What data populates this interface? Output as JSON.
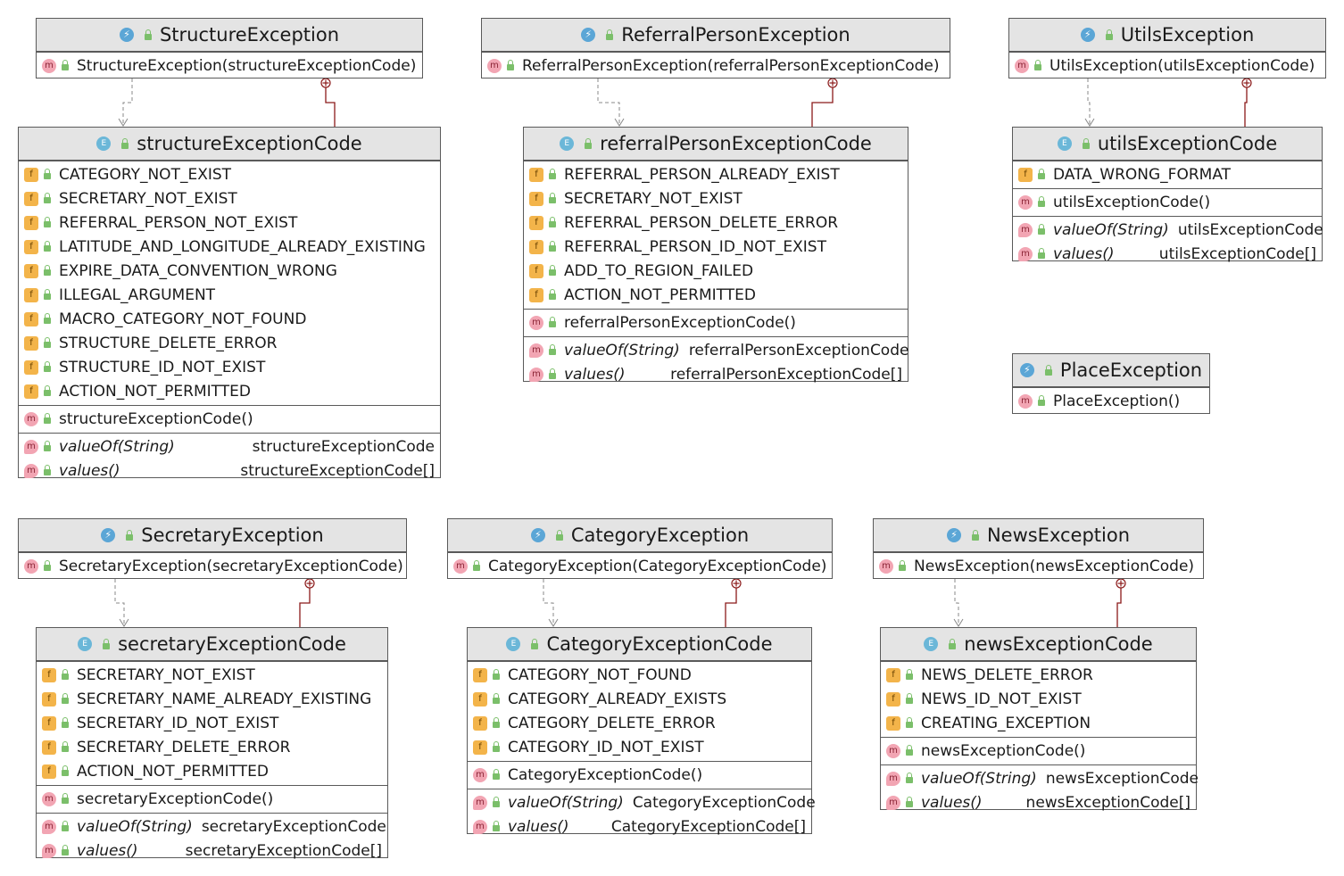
{
  "exceptions": {
    "structure": {
      "name": "StructureException",
      "ctor": "StructureException(structureExceptionCode)"
    },
    "referral": {
      "name": "ReferralPersonException",
      "ctor": "ReferralPersonException(referralPersonExceptionCode)"
    },
    "utils": {
      "name": "UtilsException",
      "ctor": "UtilsException(utilsExceptionCode)"
    },
    "place": {
      "name": "PlaceException",
      "ctor": "PlaceException()"
    },
    "secretary": {
      "name": "SecretaryException",
      "ctor": "SecretaryException(secretaryExceptionCode)"
    },
    "category": {
      "name": "CategoryException",
      "ctor": "CategoryException(CategoryExceptionCode)"
    },
    "news": {
      "name": "NewsException",
      "ctor": "NewsException(newsExceptionCode)"
    }
  },
  "enums": {
    "structure": {
      "name": "structureExceptionCode",
      "fields": [
        "CATEGORY_NOT_EXIST",
        "SECRETARY_NOT_EXIST",
        "REFERRAL_PERSON_NOT_EXIST",
        "LATITUDE_AND_LONGITUDE_ALREADY_EXISTING",
        "EXPIRE_DATA_CONVENTION_WRONG",
        "ILLEGAL_ARGUMENT",
        "MACRO_CATEGORY_NOT_FOUND",
        "STRUCTURE_DELETE_ERROR",
        "STRUCTURE_ID_NOT_EXIST",
        "ACTION_NOT_PERMITTED"
      ],
      "ctor": "structureExceptionCode()",
      "valueOf": "valueOf(String)",
      "valueOf_type": "structureExceptionCode",
      "values": "values()",
      "values_type": "structureExceptionCode[]"
    },
    "referral": {
      "name": "referralPersonExceptionCode",
      "fields": [
        "REFERRAL_PERSON_ALREADY_EXIST",
        "SECRETARY_NOT_EXIST",
        "REFERRAL_PERSON_DELETE_ERROR",
        "REFERRAL_PERSON_ID_NOT_EXIST",
        "ADD_TO_REGION_FAILED",
        "ACTION_NOT_PERMITTED"
      ],
      "ctor": "referralPersonExceptionCode()",
      "valueOf": "valueOf(String)",
      "valueOf_type": "referralPersonExceptionCode",
      "values": "values()",
      "values_type": "referralPersonExceptionCode[]"
    },
    "utils": {
      "name": "utilsExceptionCode",
      "fields": [
        "DATA_WRONG_FORMAT"
      ],
      "ctor": "utilsExceptionCode()",
      "valueOf": "valueOf(String)",
      "valueOf_type": "utilsExceptionCode",
      "values": "values()",
      "values_type": "utilsExceptionCode[]"
    },
    "secretary": {
      "name": "secretaryExceptionCode",
      "fields": [
        "SECRETARY_NOT_EXIST",
        "SECRETARY_NAME_ALREADY_EXISTING",
        "SECRETARY_ID_NOT_EXIST",
        "SECRETARY_DELETE_ERROR",
        "ACTION_NOT_PERMITTED"
      ],
      "ctor": "secretaryExceptionCode()",
      "valueOf": "valueOf(String)",
      "valueOf_type": "secretaryExceptionCode",
      "values": "values()",
      "values_type": "secretaryExceptionCode[]"
    },
    "category": {
      "name": "CategoryExceptionCode",
      "fields": [
        "CATEGORY_NOT_FOUND",
        "CATEGORY_ALREADY_EXISTS",
        "CATEGORY_DELETE_ERROR",
        "CATEGORY_ID_NOT_EXIST"
      ],
      "ctor": "CategoryExceptionCode()",
      "valueOf": "valueOf(String)",
      "valueOf_type": "CategoryExceptionCode",
      "values": "values()",
      "values_type": "CategoryExceptionCode[]"
    },
    "news": {
      "name": "newsExceptionCode",
      "fields": [
        "NEWS_DELETE_ERROR",
        "NEWS_ID_NOT_EXIST",
        "CREATING_EXCEPTION"
      ],
      "ctor": "newsExceptionCode()",
      "valueOf": "valueOf(String)",
      "valueOf_type": "newsExceptionCode",
      "values": "values()",
      "values_type": "newsExceptionCode[]"
    }
  },
  "icons": {
    "exception": "lightning-icon",
    "enum": "enum-icon",
    "method": "method-icon",
    "field": "field-icon",
    "static_method": "static-method-icon",
    "visibility": "lock-icon"
  },
  "colors": {
    "header_bg": "#e4e4e4",
    "border": "#5a5a5a",
    "dependency_line": "#888888",
    "nested_line": "#8b1a1a"
  }
}
